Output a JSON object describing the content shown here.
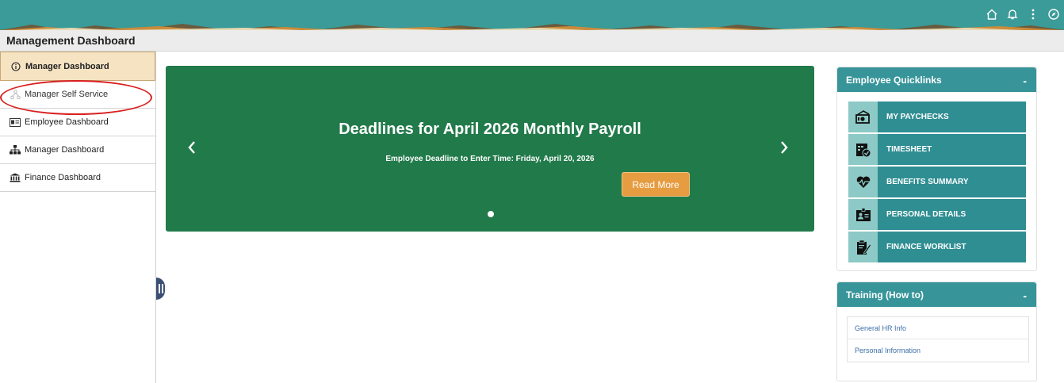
{
  "header": {
    "title": "Management Dashboard",
    "icons": [
      "home-icon",
      "bell-icon",
      "kebab-menu-icon",
      "compass-icon"
    ]
  },
  "sidebar": {
    "items": [
      {
        "label": "Manager Dashboard",
        "icon": "info-circle-icon",
        "active": true
      },
      {
        "label": "Manager Self Service",
        "icon": "hierarchy-icon",
        "active": false
      },
      {
        "label": "Employee Dashboard",
        "icon": "id-card-icon",
        "active": false
      },
      {
        "label": "Manager Dashboard",
        "icon": "org-chart-icon",
        "active": false
      },
      {
        "label": "Finance Dashboard",
        "icon": "bank-icon",
        "active": false
      }
    ]
  },
  "carousel": {
    "headline": "Deadlines for April 2026 Monthly Payroll",
    "subtext": "Employee Deadline to Enter Time:  Friday, April 20, 2026",
    "button": "Read More",
    "prev": "‹",
    "next": "›"
  },
  "quicklinks": {
    "title": "Employee Quicklinks",
    "collapse": "-",
    "items": [
      {
        "label": "MY PAYCHECKS",
        "icon": "paycheck-icon"
      },
      {
        "label": "TIMESHEET",
        "icon": "timesheet-icon"
      },
      {
        "label": "BENEFITS SUMMARY",
        "icon": "heartbeat-icon"
      },
      {
        "label": "PERSONAL DETAILS",
        "icon": "personal-details-icon"
      },
      {
        "label": "FINANCE WORKLIST",
        "icon": "clipboard-edit-icon"
      }
    ]
  },
  "training": {
    "title": "Training (How to)",
    "collapse": "-",
    "items": [
      {
        "label": "General HR Info"
      },
      {
        "label": "Personal Information"
      }
    ]
  },
  "colors": {
    "banner": "#3a9b98",
    "carousel": "#217a4a",
    "read_more": "#e69c40",
    "panel_header": "#37959a",
    "active_nav": "#f6e3c2",
    "annotation": "#d91f1f"
  }
}
